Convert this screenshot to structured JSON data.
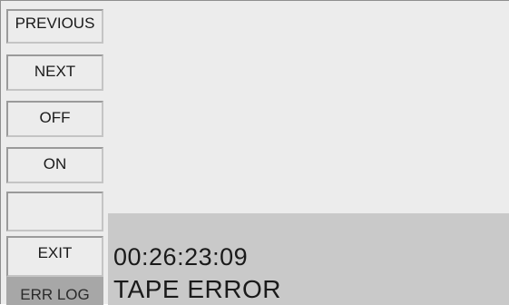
{
  "softkeys": [
    {
      "label": "PREVIOUS"
    },
    {
      "label": "NEXT"
    },
    {
      "label": "OFF"
    },
    {
      "label": "ON"
    },
    {
      "label": ""
    },
    {
      "label": "EXIT"
    },
    {
      "label": "ERR LOG"
    }
  ],
  "status": {
    "timecode": "00:26:23:09",
    "message": "TAPE ERROR"
  },
  "colors": {
    "screen_bg": "#ececec",
    "status_panel_bg": "#c9c9c9",
    "active_key_bg": "#a7a7a7",
    "text": "#1a1a1a"
  }
}
